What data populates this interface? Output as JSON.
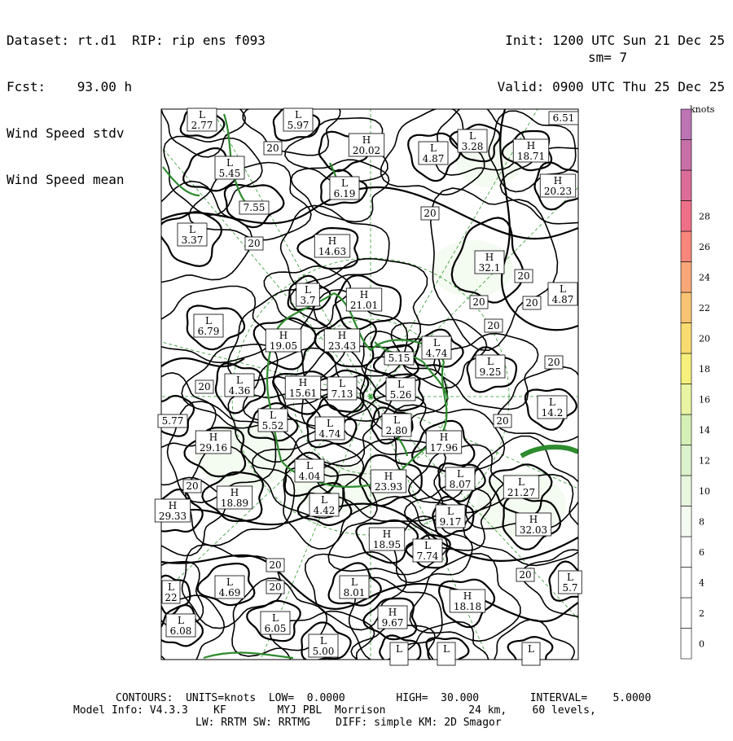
{
  "header": {
    "dataset": "Dataset: rt.d1  RIP: rip ens f093",
    "fcst": "Fcst:    93.00 h",
    "field1": "Wind Speed stdv",
    "field2": "Wind Speed mean",
    "init": "Init: 1200 UTC Sun 21 Dec 25",
    "valid": "Valid: 0900 UTC Thu 25 Dec 25",
    "smoothing": "sm= 7"
  },
  "colorbar": {
    "units": "knots",
    "ticks": [
      "0",
      "2",
      "4",
      "6",
      "8",
      "10",
      "12",
      "14",
      "16",
      "18",
      "20",
      "22",
      "24",
      "26",
      "28"
    ],
    "colors": [
      "#ffffff",
      "#ffffff",
      "#ffffff",
      "#ffffff",
      "#f4fbf0",
      "#e8f6de",
      "#dcf2cc",
      "#d4f0b6",
      "#e9f4a4",
      "#f6f07c",
      "#f8dc70",
      "#f8c474",
      "#f8a878",
      "#f8867c",
      "#ee7088",
      "#dc6c98",
      "#c870a8",
      "#bc74b4"
    ]
  },
  "map_labels": [
    {
      "t": "L",
      "v": "2.77"
    },
    {
      "t": "L",
      "v": "5.97"
    },
    {
      "t": "",
      "v": "20"
    },
    {
      "t": "H",
      "v": "20.02"
    },
    {
      "t": "L",
      "v": "4.87"
    },
    {
      "t": "L",
      "v": "3.28"
    },
    {
      "t": "H",
      "v": "18.71"
    },
    {
      "t": "",
      "v": "6.51"
    },
    {
      "t": "L",
      "v": "5.45"
    },
    {
      "t": "L",
      "v": "6.19"
    },
    {
      "t": "H",
      "v": "20.23"
    },
    {
      "t": "",
      "v": "7.55"
    },
    {
      "t": "",
      "v": "20"
    },
    {
      "t": "L",
      "v": "3.37"
    },
    {
      "t": "",
      "v": "20"
    },
    {
      "t": "H",
      "v": "14.63"
    },
    {
      "t": "H",
      "v": "32.1"
    },
    {
      "t": "",
      "v": "20"
    },
    {
      "t": "L",
      "v": "3.7"
    },
    {
      "t": "H",
      "v": "21.01"
    },
    {
      "t": "",
      "v": "20"
    },
    {
      "t": "",
      "v": "20"
    },
    {
      "t": "L",
      "v": "4.87"
    },
    {
      "t": "L",
      "v": "6.79"
    },
    {
      "t": "",
      "v": "20"
    },
    {
      "t": "H",
      "v": "19.05"
    },
    {
      "t": "H",
      "v": "23.43"
    },
    {
      "t": "",
      "v": "5.15"
    },
    {
      "t": "L",
      "v": "4.74"
    },
    {
      "t": "L",
      "v": "9.25"
    },
    {
      "t": "",
      "v": "20"
    },
    {
      "t": "",
      "v": "20"
    },
    {
      "t": "L",
      "v": "4.36"
    },
    {
      "t": "H",
      "v": "15.61"
    },
    {
      "t": "L",
      "v": "7.13"
    },
    {
      "t": "L",
      "v": "5.26"
    },
    {
      "t": "",
      "v": "5.77"
    },
    {
      "t": "L",
      "v": "5.52"
    },
    {
      "t": "L",
      "v": "4.74"
    },
    {
      "t": "L",
      "v": "2.80"
    },
    {
      "t": "",
      "v": "20"
    },
    {
      "t": "L",
      "v": "14.2"
    },
    {
      "t": "H",
      "v": "29.16"
    },
    {
      "t": "H",
      "v": "17.96"
    },
    {
      "t": "L",
      "v": "4.04"
    },
    {
      "t": "H",
      "v": "23.93"
    },
    {
      "t": "L",
      "v": "8.07"
    },
    {
      "t": "",
      "v": "20"
    },
    {
      "t": "H",
      "v": "18.89"
    },
    {
      "t": "L",
      "v": "4.42"
    },
    {
      "t": "H",
      "v": "29.33"
    },
    {
      "t": "L",
      "v": "21.27"
    },
    {
      "t": "L",
      "v": "9.17"
    },
    {
      "t": "H",
      "v": "32.03"
    },
    {
      "t": "H",
      "v": "18.95"
    },
    {
      "t": "L",
      "v": "7.74"
    },
    {
      "t": "",
      "v": "20"
    },
    {
      "t": "",
      "v": "20"
    },
    {
      "t": "",
      "v": "20"
    },
    {
      "t": "L",
      "v": "4.69"
    },
    {
      "t": "L",
      "v": "8.01"
    },
    {
      "t": "L",
      "v": "5.7"
    },
    {
      "t": "L",
      "v": "22"
    },
    {
      "t": "H",
      "v": "18.18"
    },
    {
      "t": "L",
      "v": "6.05"
    },
    {
      "t": "L",
      "v": "6.08"
    },
    {
      "t": "H",
      "v": "9.67"
    },
    {
      "t": "L",
      "v": "5.00"
    },
    {
      "t": "L",
      "v": ""
    },
    {
      "t": "L",
      "v": ""
    },
    {
      "t": "L",
      "v": ""
    }
  ],
  "footer": {
    "line1": "CONTOURS:  UNITS=knots  LOW=  0.0000        HIGH=  30.000        INTERVAL=    5.0000",
    "line2": "Model Info: V4.3.3    KF        MYJ PBL  Morrison             24 km,    60 levels,",
    "line3": "LW: RRTM SW: RRTMG    DIFF: simple KM: 2D Smagor"
  },
  "colors": {
    "contour": "#000000",
    "coast": "#2e8b2e",
    "grid": "#2e9a2e"
  }
}
